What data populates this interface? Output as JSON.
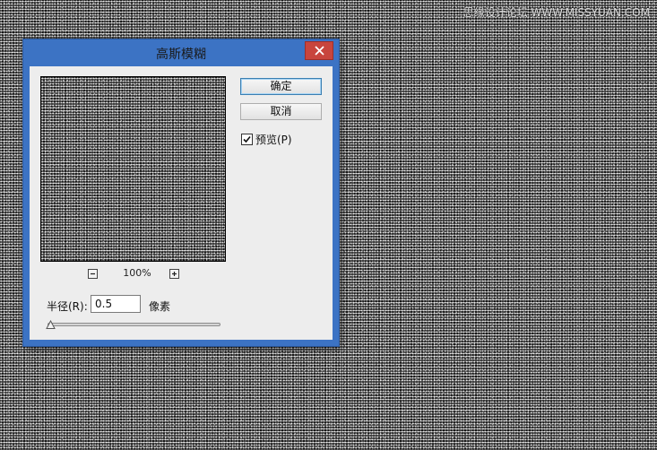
{
  "watermark": "思缘设计论坛 WWW.MISSYUAN.COM",
  "dialog": {
    "title": "高斯模糊",
    "close_icon": "close-icon",
    "ok_label": "确定",
    "cancel_label": "取消",
    "preview_label": "预览(P)",
    "preview_checked": true,
    "zoom_level": "100%",
    "zoom_out_icon": "minus-icon",
    "zoom_in_icon": "plus-icon",
    "radius_label": "半径(R):",
    "radius_value": "0.5",
    "radius_unit": "像素",
    "radius_slider_fraction": 0.01
  },
  "colors": {
    "titlebar": "#3c73c4",
    "close_button": "#c8453d",
    "dialog_body": "#ededed",
    "canvas_noise_base": "#3a3a3a"
  }
}
